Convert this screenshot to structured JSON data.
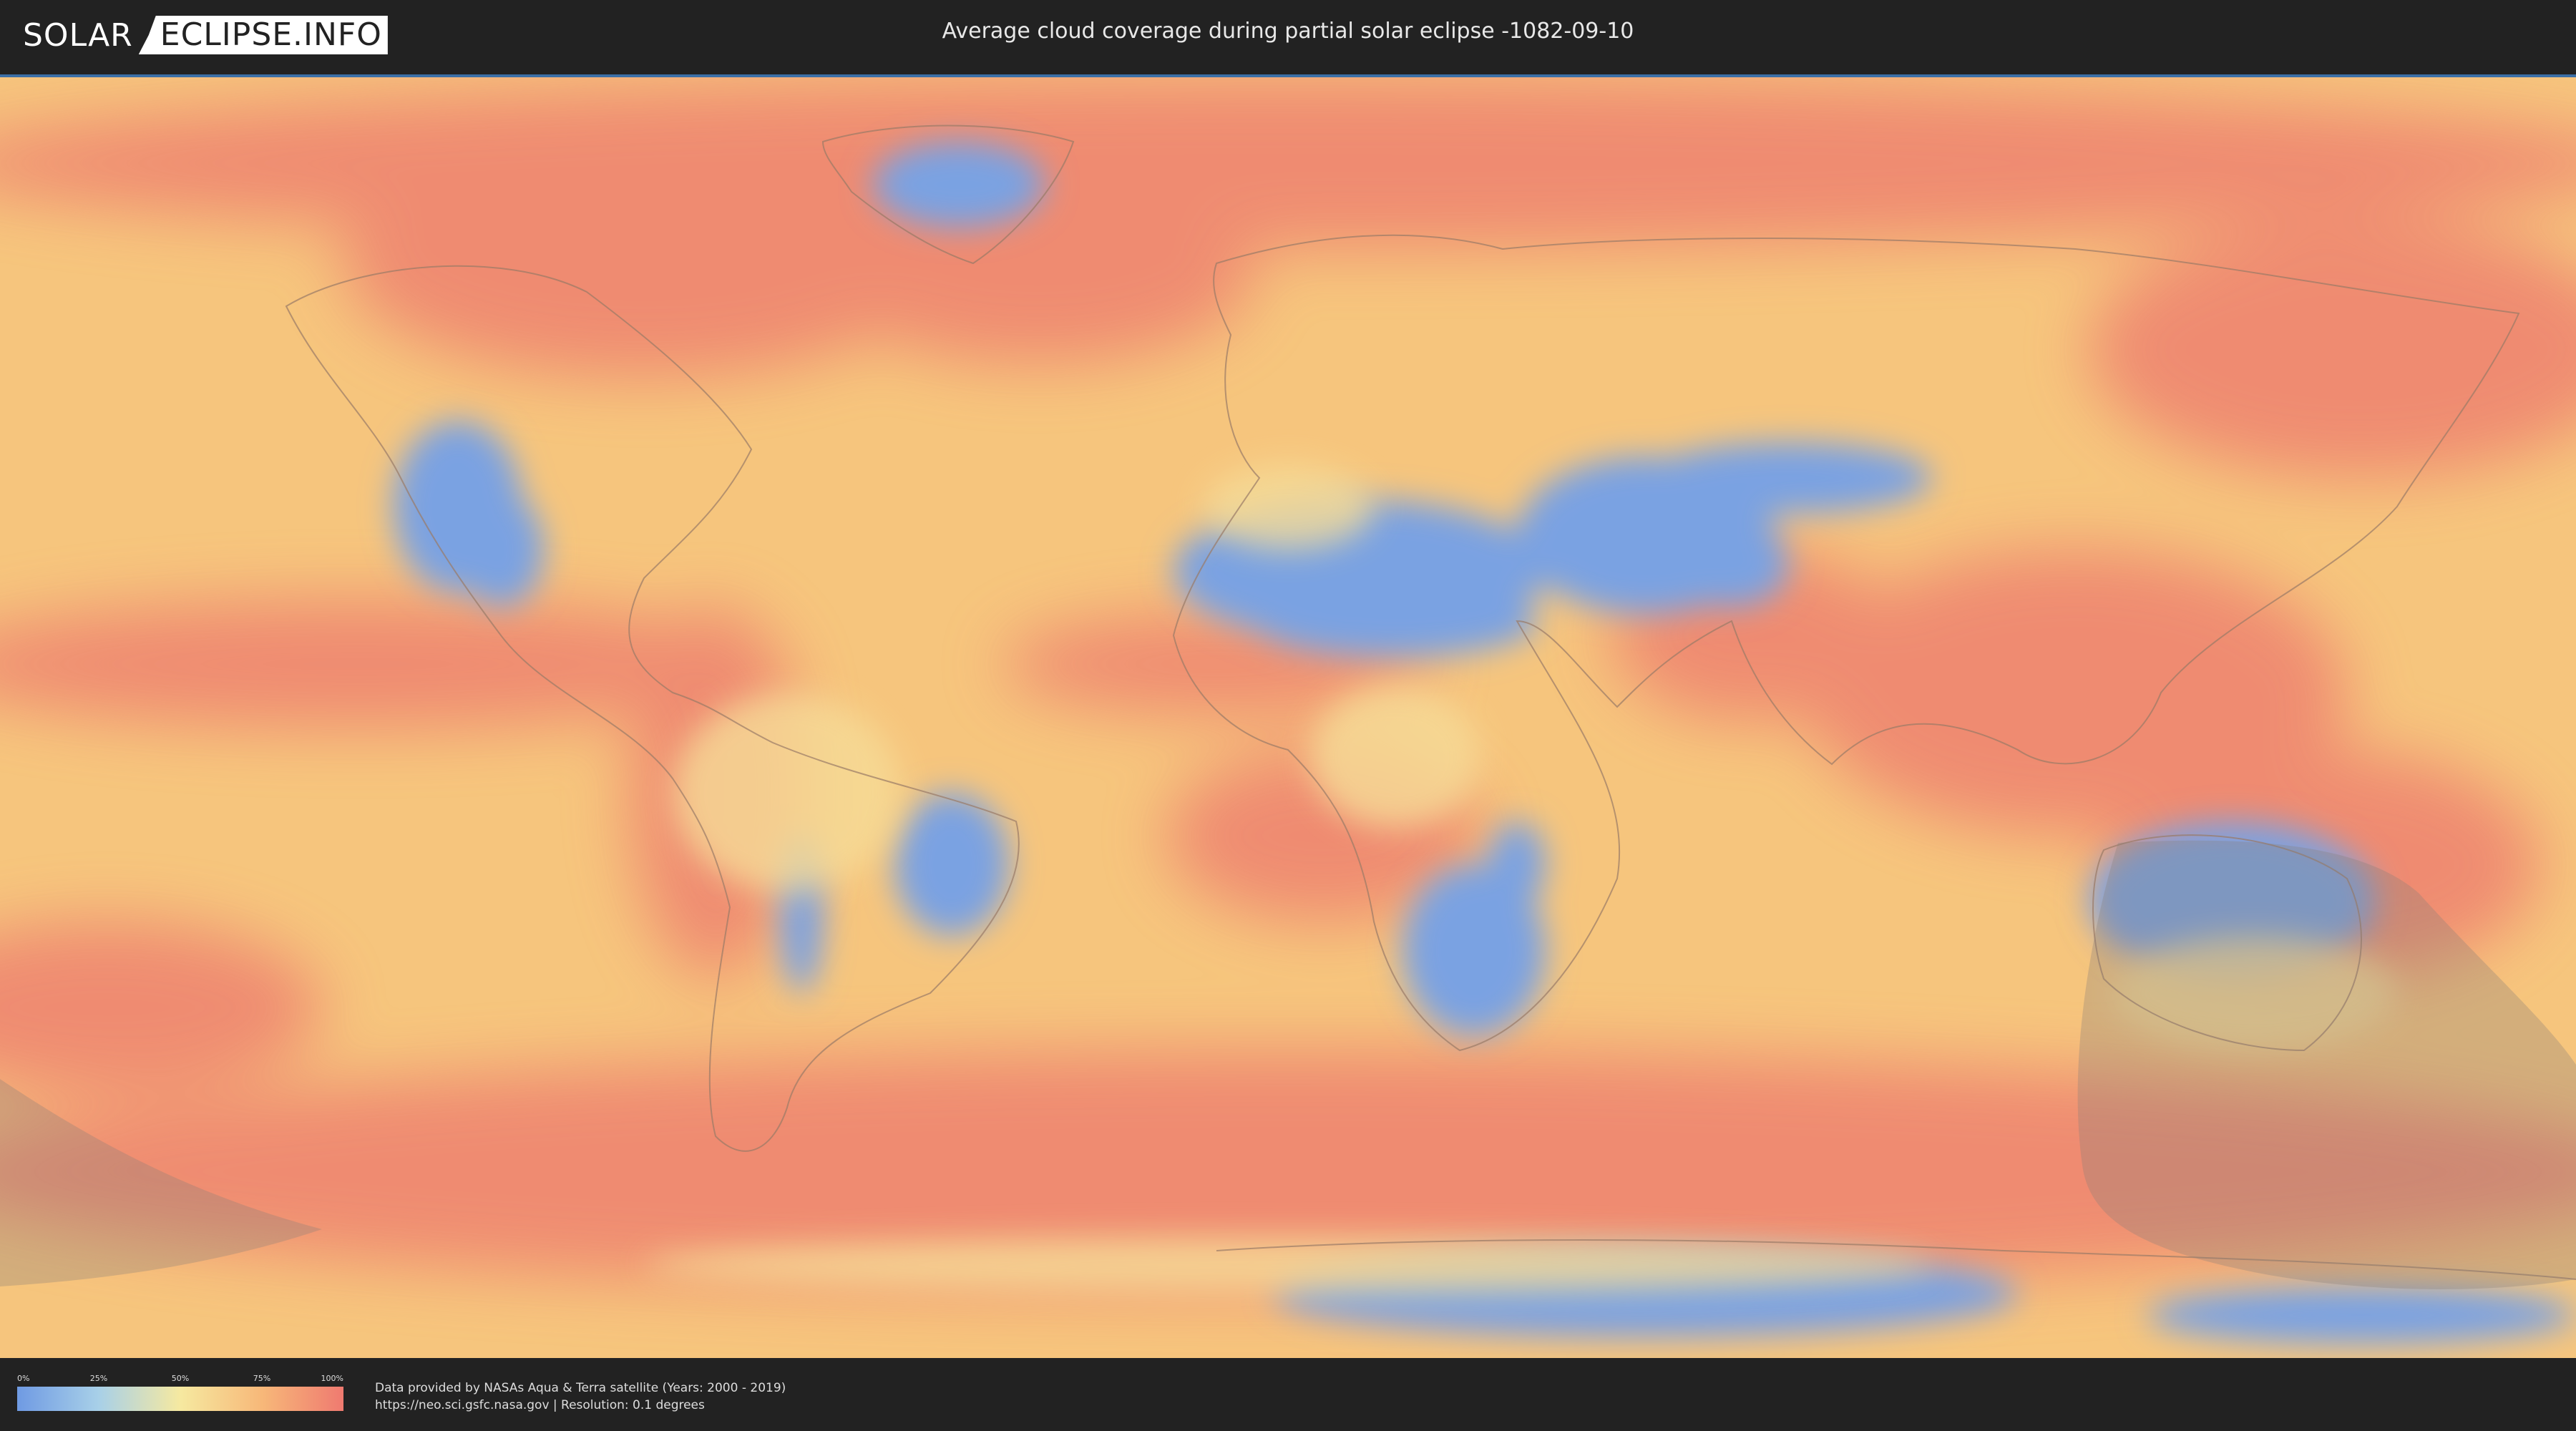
{
  "header": {
    "logo_left": "SOLAR",
    "logo_right": "ECLIPSE.INFO",
    "title": "Average cloud coverage during partial solar eclipse -1082-09-10"
  },
  "legend": {
    "ticks": [
      "0%",
      "25%",
      "50%",
      "75%",
      "100%"
    ],
    "colors": [
      "#6f9ae3",
      "#a8d0e8",
      "#f6e9a0",
      "#f7b879",
      "#ef7a70"
    ]
  },
  "credits": {
    "line1": "Data provided by NASAs Aqua & Terra satellite (Years: 2000 - 2019)",
    "line2": "https://neo.sci.gsfc.nasa.gov | Resolution: 0.1 degrees"
  },
  "colors": {
    "background": "#222222",
    "clear": "#6f9ae3",
    "cloudy": "#ef7a70",
    "eclipse_shade": "#8a7f78"
  }
}
